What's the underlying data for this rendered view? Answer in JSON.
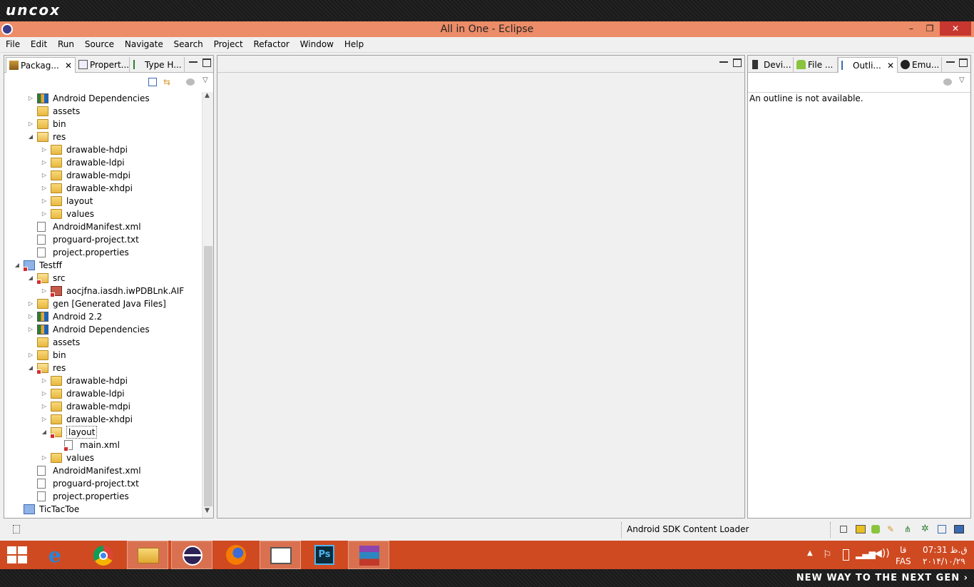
{
  "banner": {
    "logo": "uncox",
    "tagline": "NEW WAY TO THE NEXT GEN ›"
  },
  "window": {
    "title": "All in One - Eclipse",
    "minimize": "–",
    "maximize": "❐",
    "close": "✕"
  },
  "menu": [
    "File",
    "Edit",
    "Run",
    "Source",
    "Navigate",
    "Search",
    "Project",
    "Refactor",
    "Window",
    "Help"
  ],
  "left_panel": {
    "tabs": [
      {
        "label": "Packag...",
        "close": "✕"
      },
      {
        "label": "Propert..."
      },
      {
        "label": "Type H..."
      }
    ]
  },
  "tree": [
    {
      "label": "Android Dependencies",
      "level": 1,
      "arrow": "▷",
      "icon": "lib"
    },
    {
      "label": "assets",
      "level": 1,
      "arrow": "",
      "icon": "folder"
    },
    {
      "label": "bin",
      "level": 1,
      "arrow": "▷",
      "icon": "folder"
    },
    {
      "label": "res",
      "level": 1,
      "arrow": "◢",
      "icon": "folder-open"
    },
    {
      "label": "drawable-hdpi",
      "level": 2,
      "arrow": "▷",
      "icon": "folder"
    },
    {
      "label": "drawable-ldpi",
      "level": 2,
      "arrow": "▷",
      "icon": "folder"
    },
    {
      "label": "drawable-mdpi",
      "level": 2,
      "arrow": "▷",
      "icon": "folder"
    },
    {
      "label": "drawable-xhdpi",
      "level": 2,
      "arrow": "▷",
      "icon": "folder"
    },
    {
      "label": "layout",
      "level": 2,
      "arrow": "▷",
      "icon": "folder"
    },
    {
      "label": "values",
      "level": 2,
      "arrow": "▷",
      "icon": "folder"
    },
    {
      "label": "AndroidManifest.xml",
      "level": 1,
      "arrow": "",
      "icon": "file"
    },
    {
      "label": "proguard-project.txt",
      "level": 1,
      "arrow": "",
      "icon": "file"
    },
    {
      "label": "project.properties",
      "level": 1,
      "arrow": "",
      "icon": "file"
    },
    {
      "label": "Testff",
      "level": 0,
      "arrow": "◢",
      "icon": "proj",
      "error": true
    },
    {
      "label": "src",
      "level": 1,
      "arrow": "◢",
      "icon": "folder-open",
      "error": true
    },
    {
      "label": "aocjfna.iasdh.iwPDBLnk.AIF",
      "level": 2,
      "arrow": "▷",
      "icon": "pkg",
      "error": true
    },
    {
      "label": "gen [Generated Java Files]",
      "level": 1,
      "arrow": "▷",
      "icon": "folder"
    },
    {
      "label": "Android 2.2",
      "level": 1,
      "arrow": "▷",
      "icon": "lib"
    },
    {
      "label": "Android Dependencies",
      "level": 1,
      "arrow": "▷",
      "icon": "lib"
    },
    {
      "label": "assets",
      "level": 1,
      "arrow": "",
      "icon": "folder"
    },
    {
      "label": "bin",
      "level": 1,
      "arrow": "▷",
      "icon": "folder"
    },
    {
      "label": "res",
      "level": 1,
      "arrow": "◢",
      "icon": "folder-open",
      "error": true
    },
    {
      "label": "drawable-hdpi",
      "level": 2,
      "arrow": "▷",
      "icon": "folder"
    },
    {
      "label": "drawable-ldpi",
      "level": 2,
      "arrow": "▷",
      "icon": "folder"
    },
    {
      "label": "drawable-mdpi",
      "level": 2,
      "arrow": "▷",
      "icon": "folder"
    },
    {
      "label": "drawable-xhdpi",
      "level": 2,
      "arrow": "▷",
      "icon": "folder"
    },
    {
      "label": "layout",
      "level": 2,
      "arrow": "◢",
      "icon": "folder-open",
      "error": true,
      "selected": true
    },
    {
      "label": "main.xml",
      "level": 3,
      "arrow": "",
      "icon": "file",
      "error": true
    },
    {
      "label": "values",
      "level": 2,
      "arrow": "▷",
      "icon": "folder"
    },
    {
      "label": "AndroidManifest.xml",
      "level": 1,
      "arrow": "",
      "icon": "file"
    },
    {
      "label": "proguard-project.txt",
      "level": 1,
      "arrow": "",
      "icon": "file"
    },
    {
      "label": "project.properties",
      "level": 1,
      "arrow": "",
      "icon": "file"
    },
    {
      "label": "TicTacToe",
      "level": 0,
      "arrow": "",
      "icon": "proj"
    }
  ],
  "right_panel": {
    "tabs": [
      {
        "label": "Devi..."
      },
      {
        "label": "File ..."
      },
      {
        "label": "Outli...",
        "close": "✕"
      },
      {
        "label": "Emu..."
      }
    ],
    "message": "An outline is not available."
  },
  "status": {
    "text": "Android SDK Content Loader"
  },
  "tray": {
    "lang": "FAS",
    "time": "07:31 ق.ظ",
    "date": "۲۰۱۴/۱۰/۲۹",
    "day": "قا"
  },
  "colors": {
    "titlebar": "#ec8c68",
    "taskbar": "#cf4a21",
    "close": "#c7372f"
  }
}
